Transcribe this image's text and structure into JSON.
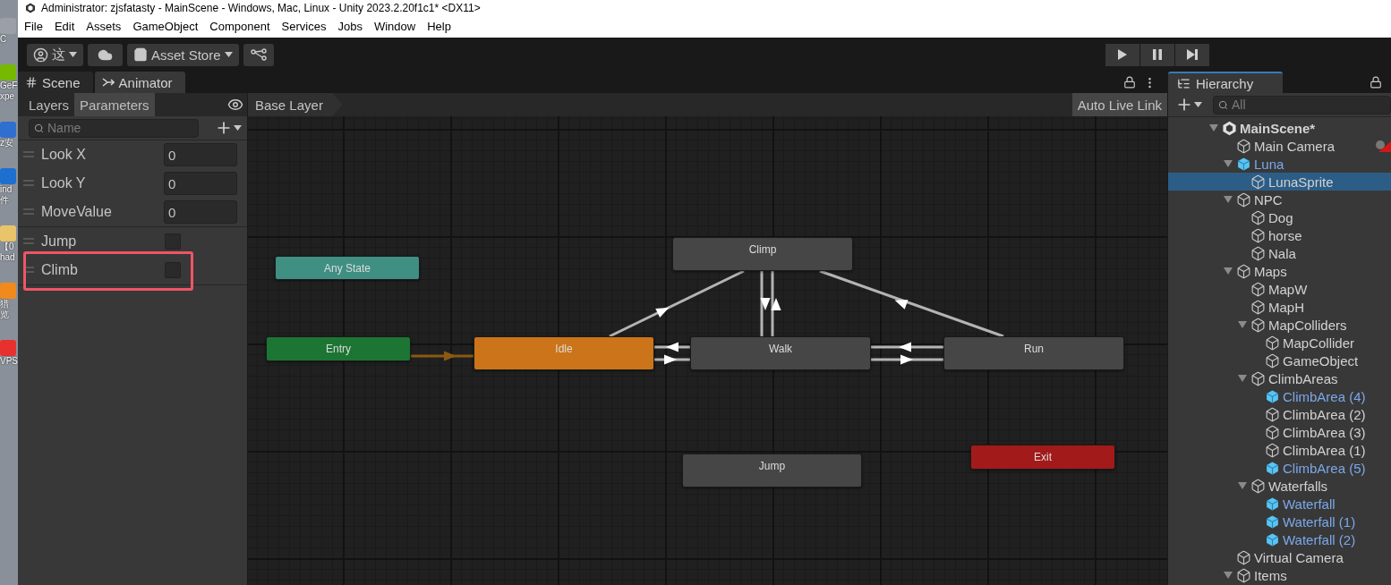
{
  "window": {
    "title": "Administrator: zjsfatasty - MainScene - Windows, Mac, Linux - Unity 2023.2.20f1c1* <DX11>"
  },
  "desktop_icons": [
    {
      "lines": [
        "C"
      ],
      "color": "#9aa0a6"
    },
    {
      "lines": [
        "GeF",
        "xpe"
      ],
      "color": "#76b900"
    },
    {
      "lines": [
        "z安"
      ],
      "color": "#2f6fd0"
    },
    {
      "lines": [
        "ind",
        "件"
      ],
      "color": "#1e6fd0"
    },
    {
      "lines": [
        "【0",
        "had"
      ],
      "color": "#e8c56a"
    },
    {
      "lines": [
        "猎",
        "览"
      ],
      "color": "#f08a1c"
    },
    {
      "lines": [
        "VPS"
      ],
      "color": "#e8312f"
    }
  ],
  "menu": [
    "File",
    "Edit",
    "Assets",
    "GameObject",
    "Component",
    "Services",
    "Jobs",
    "Window",
    "Help"
  ],
  "toolbar": {
    "account": "这",
    "store": "Asset Store"
  },
  "tabs": [
    {
      "label": "Scene",
      "selected": false
    },
    {
      "label": "Animator",
      "selected": true
    }
  ],
  "animator": {
    "panel_tabs": [
      {
        "label": "Layers",
        "selected": false
      },
      {
        "label": "Parameters",
        "selected": true
      }
    ],
    "search": {
      "placeholder": "Name"
    },
    "parameters": [
      {
        "name": "Look X",
        "kind": "float",
        "value": "0",
        "highlighted": false
      },
      {
        "name": "Look Y",
        "kind": "float",
        "value": "0",
        "highlighted": false
      },
      {
        "name": "MoveValue",
        "kind": "float",
        "value": "0",
        "highlighted": false
      },
      {
        "name": "Jump",
        "kind": "bool",
        "checked": false,
        "highlighted": false
      },
      {
        "name": "Climb",
        "kind": "bool",
        "checked": false,
        "highlighted": true
      }
    ],
    "breadcrumb": "Base Layer",
    "live_link": "Auto Live Link",
    "states": [
      {
        "label": "Any State",
        "kind": "any"
      },
      {
        "label": "Entry",
        "kind": "entry"
      },
      {
        "label": "Idle",
        "kind": "default"
      },
      {
        "label": "Walk",
        "kind": "state"
      },
      {
        "label": "Run",
        "kind": "state"
      },
      {
        "label": "Climp",
        "kind": "state"
      },
      {
        "label": "Jump",
        "kind": "state"
      },
      {
        "label": "Exit",
        "kind": "exit"
      }
    ]
  },
  "hierarchy": {
    "title": "Hierarchy",
    "search": {
      "placeholder": "All"
    },
    "scene": {
      "name": "MainScene*",
      "expanded": true,
      "children": [
        {
          "name": "Main Camera",
          "prefab": false,
          "selected": false,
          "gizmo": true
        },
        {
          "name": "Luna",
          "prefab": true,
          "selected": false,
          "expanded": true,
          "children": [
            {
              "name": "LunaSprite",
              "prefab": false,
              "selected": true
            }
          ]
        },
        {
          "name": "NPC",
          "prefab": false,
          "selected": false,
          "expanded": true,
          "children": [
            {
              "name": "Dog",
              "prefab": false,
              "selected": false
            },
            {
              "name": "horse",
              "prefab": false,
              "selected": false
            },
            {
              "name": "Nala",
              "prefab": false,
              "selected": false
            }
          ]
        },
        {
          "name": "Maps",
          "prefab": false,
          "selected": false,
          "expanded": true,
          "children": [
            {
              "name": "MapW",
              "prefab": false,
              "selected": false
            },
            {
              "name": "MapH",
              "prefab": false,
              "selected": false
            },
            {
              "name": "MapColliders",
              "prefab": false,
              "selected": false,
              "expanded": true,
              "children": [
                {
                  "name": "MapCollider",
                  "prefab": false,
                  "selected": false
                },
                {
                  "name": "GameObject",
                  "prefab": false,
                  "selected": false
                }
              ]
            },
            {
              "name": "ClimbAreas",
              "prefab": false,
              "selected": false,
              "expanded": true,
              "children": [
                {
                  "name": "ClimbArea (4)",
                  "prefab": true,
                  "selected": false
                },
                {
                  "name": "ClimbArea (2)",
                  "prefab": false,
                  "selected": false
                },
                {
                  "name": "ClimbArea (3)",
                  "prefab": false,
                  "selected": false
                },
                {
                  "name": "ClimbArea (1)",
                  "prefab": false,
                  "selected": false
                },
                {
                  "name": "ClimbArea (5)",
                  "prefab": true,
                  "selected": false
                }
              ]
            },
            {
              "name": "Waterfalls",
              "prefab": false,
              "selected": false,
              "expanded": true,
              "children": [
                {
                  "name": "Waterfall",
                  "prefab": true,
                  "selected": false
                },
                {
                  "name": "Waterfall (1)",
                  "prefab": true,
                  "selected": false
                },
                {
                  "name": "Waterfall (2)",
                  "prefab": true,
                  "selected": false
                }
              ]
            }
          ]
        },
        {
          "name": "Virtual Camera",
          "prefab": false,
          "selected": false
        },
        {
          "name": "Items",
          "prefab": false,
          "selected": false,
          "expanded": true
        }
      ]
    }
  }
}
